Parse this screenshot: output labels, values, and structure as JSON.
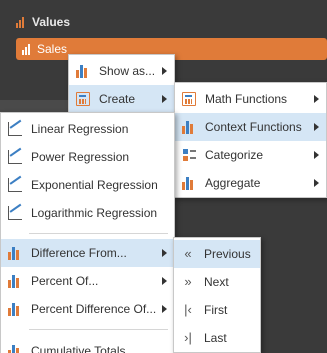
{
  "values_panel": {
    "title": "Values",
    "field": "Sales"
  },
  "menu_main": {
    "items": [
      {
        "label": "Show as...",
        "has_submenu": true,
        "icon": "show-as-icon"
      },
      {
        "label": "Create",
        "has_submenu": true,
        "icon": "calculator-icon",
        "highlighted": true
      }
    ]
  },
  "menu_create": {
    "items": [
      {
        "label": "Math Functions",
        "has_submenu": true,
        "icon": "calculator-icon"
      },
      {
        "label": "Context Functions",
        "has_submenu": true,
        "icon": "context-functions-icon",
        "highlighted": true
      },
      {
        "label": "Categorize",
        "has_submenu": true,
        "icon": "categorize-icon"
      },
      {
        "label": "Aggregate",
        "has_submenu": true,
        "icon": "aggregate-icon"
      }
    ]
  },
  "menu_context": {
    "items": [
      {
        "label": "Linear Regression",
        "icon": "linear-regression-icon"
      },
      {
        "label": "Power Regression",
        "icon": "power-regression-icon"
      },
      {
        "label": "Exponential Regression",
        "icon": "exponential-regression-icon"
      },
      {
        "label": "Logarithmic Regression",
        "icon": "logarithmic-regression-icon"
      },
      {
        "label": "Difference From...",
        "has_submenu": true,
        "icon": "difference-icon",
        "highlighted": true
      },
      {
        "label": "Percent Of...",
        "has_submenu": true,
        "icon": "percent-of-icon"
      },
      {
        "label": "Percent Difference Of...",
        "has_submenu": true,
        "icon": "percent-difference-icon"
      },
      {
        "label": "Cumulative Totals",
        "icon": "cumulative-totals-icon"
      }
    ]
  },
  "menu_difference": {
    "items": [
      {
        "label": "Previous",
        "icon": "double-left-icon",
        "glyph": "«",
        "highlighted": true
      },
      {
        "label": "Next",
        "icon": "double-right-icon",
        "glyph": "»"
      },
      {
        "label": "First",
        "icon": "first-icon",
        "glyph": "|‹"
      },
      {
        "label": "Last",
        "icon": "last-icon",
        "glyph": "›|"
      }
    ]
  },
  "colors": {
    "accent": "#e07b39",
    "highlight": "#d5e6f5",
    "panel_bg": "#3a3a3a",
    "icon_blue": "#3c7fc3"
  }
}
